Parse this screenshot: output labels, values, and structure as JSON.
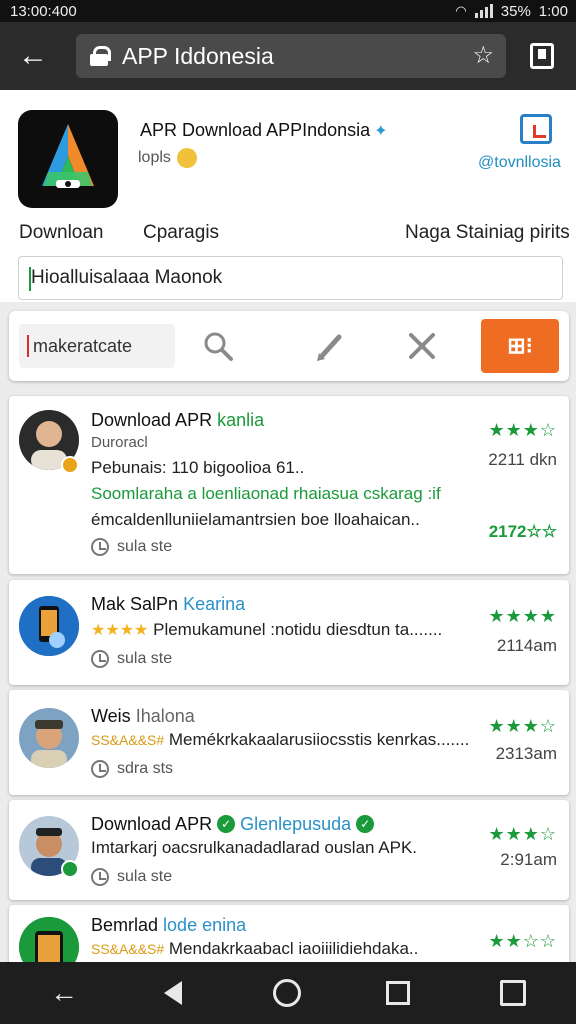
{
  "status_bar": {
    "time": "13:00:400",
    "battery": "35%",
    "clock_right": "1:00"
  },
  "browser": {
    "url_text": "APP Iddonesia",
    "star_glyph": "☆"
  },
  "app": {
    "title": "APR Download APPIndonsia",
    "subtitle": "lopls",
    "handle": "@tovnllosia",
    "meta_left": "Downloan",
    "meta_mid": "Cparagis",
    "meta_right": "Naga Stainiag pirits",
    "input_value": "Hioalluisalaaa Maonok"
  },
  "toolbar": {
    "text_field": "makeratcate",
    "orange_label": "⊞⁝"
  },
  "list": [
    {
      "name_main": "Download APR",
      "name_accent": "kanlia",
      "line1": "Duroracl",
      "line2": "Pebunais: 110 bigoolioa 61..",
      "line3": "Soomlaraha a loenliaonad rhaiasua cskarag :if",
      "line4": "émcaldenlluniielamantrsien boe lloahaican..",
      "status": "sula ste",
      "rating": "★★★☆",
      "time": "2211 dkn",
      "count": "2172☆☆"
    },
    {
      "name_main": "Mak SalPn",
      "name_accent": "Kearina",
      "stars_text": "★★★★",
      "desc": "Plemukamunel :notidu diesdtun ta.......",
      "status": "sula ste",
      "rating": "★★★★",
      "time": "2114am"
    },
    {
      "name_main": "Weis",
      "name_accent": "Ihalona",
      "stars_text": "SS&A&&S#",
      "desc": "Memékrkakaalarusiiocsstis kenrkas.......",
      "status": "sdra sts",
      "rating": "★★★☆",
      "time": "2313am"
    },
    {
      "name_main": "Download APR",
      "name_accent": "Glenlepusuda",
      "desc": "Imtarkarj oacsrulkanadadlarad ouslan APK.",
      "status": "sula ste",
      "rating": "★★★☆",
      "time": "2:91am"
    },
    {
      "name_main": "Bemrlad",
      "name_accent": "lode enina",
      "stars_text": "SS&A&&S#",
      "desc": "Mendakrkaabacl iaoiiilidiehdaka..",
      "rating": "★★☆☆"
    }
  ],
  "colors": {
    "accent_green": "#1a9a3a",
    "accent_orange": "#ef6c23",
    "link_blue": "#2a90c8"
  }
}
